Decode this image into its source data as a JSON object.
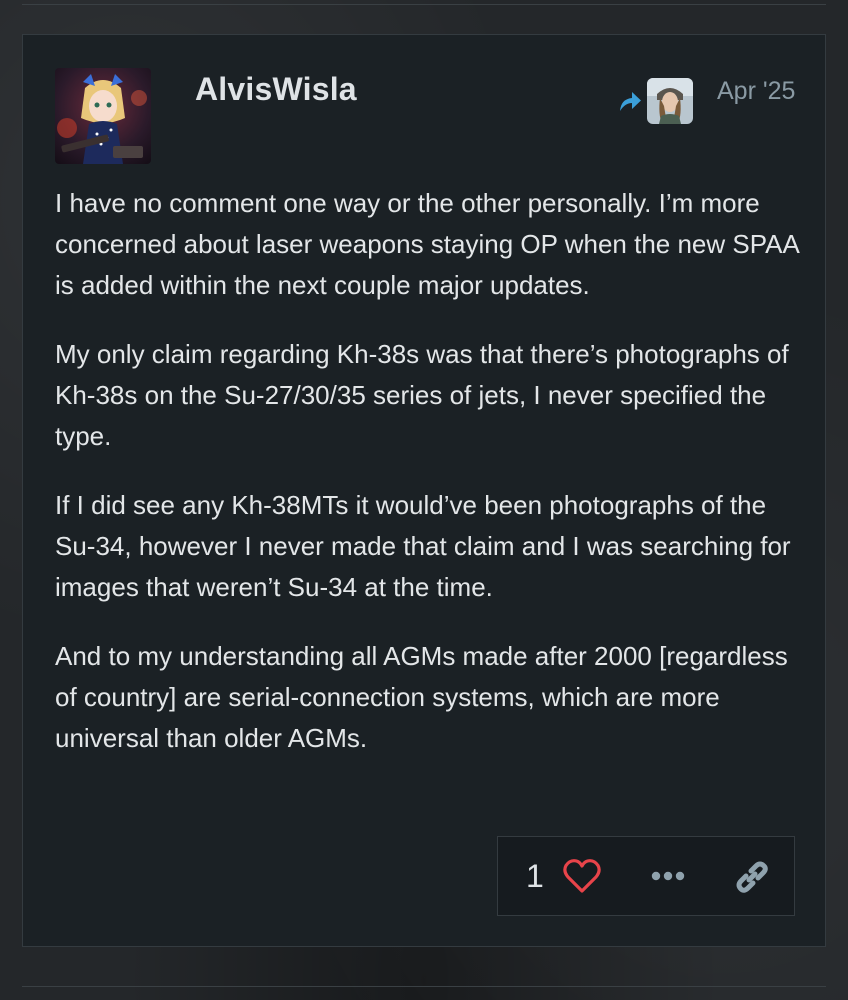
{
  "post": {
    "username": "AlvisWisla",
    "date": "Apr '25",
    "paragraphs": [
      "I have no comment one way or the other personally. I’m more concerned about laser weapons staying OP when the new SPAA is added within the next couple major updates.",
      "My only claim regarding Kh-38s was that there’s photographs of Kh-38s on the Su-27/30/35 series of jets, I never specified the type.",
      "If I did see any Kh-38MTs it would’ve been photographs of the Su-34, however I never made that claim and I was searching for images that weren’t Su-34 at the time.",
      "And to my understanding all AGMs made after 2000 [regardless of country] are serial-connection systems, which are more universal than older AGMs."
    ]
  },
  "actions": {
    "like_count": "1",
    "icons": {
      "like": "heart-icon",
      "more": "ellipsis-icon",
      "share": "link-icon",
      "reply": "reply-arrow-icon"
    }
  },
  "colors": {
    "post_bg": "#1b2125",
    "text": "#e3e6e8",
    "date": "#8a9aa4",
    "heart": "#e8444a",
    "reply_arrow": "#3b9fd9",
    "icon_muted": "#8fa2ad"
  }
}
